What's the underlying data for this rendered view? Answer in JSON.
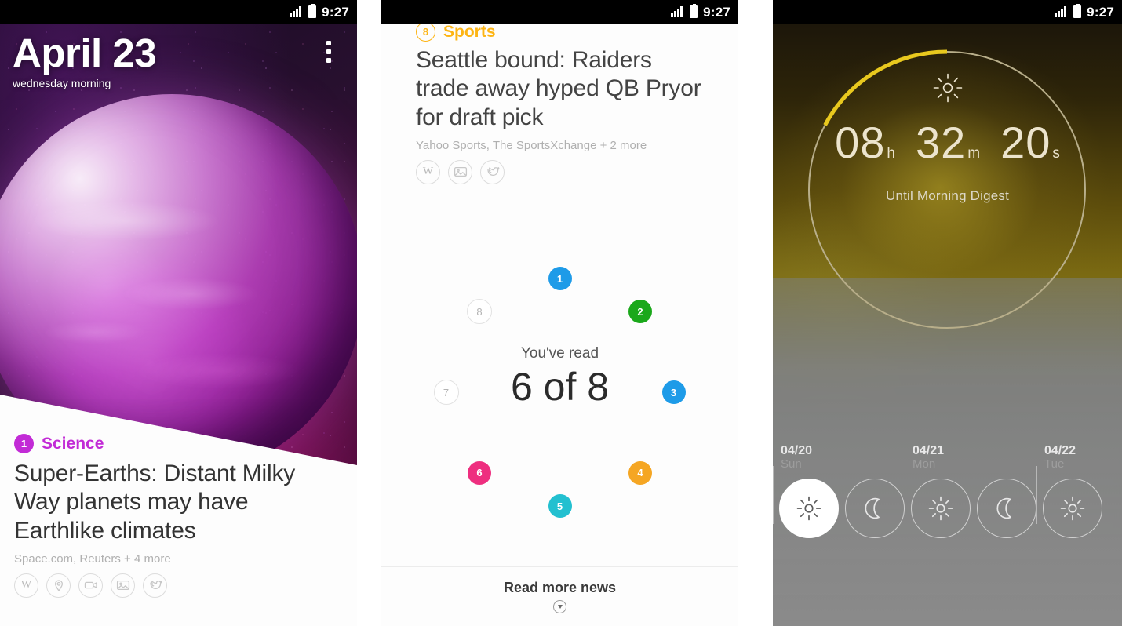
{
  "statusbar": {
    "time": "9:27",
    "signal_icon": "signal-bars-icon",
    "battery_icon": "battery-icon"
  },
  "panel1": {
    "name": "news-digest-cover",
    "date_title": "April 23",
    "date_subtitle": "wednesday morning",
    "overflow_icon": "overflow-menu-icon",
    "story": {
      "rank": "1",
      "category": "Science",
      "category_color": "#C22BD6",
      "headline": "Super-Earths: Distant Milky Way planets may have Earthlike climates",
      "sources": "Space.com, Reuters + 4 more",
      "media_icons": [
        "wikipedia-icon",
        "location-pin-icon",
        "video-camera-icon",
        "image-icon",
        "twitter-icon"
      ]
    }
  },
  "panel2": {
    "name": "news-digest-summary",
    "story": {
      "rank": "8",
      "category": "Sports",
      "category_color": "#FDB515",
      "headline": "Seattle bound: Raiders trade away hyped QB Pryor for draft pick",
      "sources": "Yahoo Sports, The SportsXchange + 2 more",
      "media_icons": [
        "wikipedia-icon",
        "image-icon",
        "twitter-icon"
      ]
    },
    "read_progress": {
      "label": "You've read",
      "count_text": "6 of 8",
      "read": 6,
      "total": 8,
      "items": [
        {
          "number": "1",
          "read": true,
          "color": "#1E9BE8"
        },
        {
          "number": "2",
          "read": true,
          "color": "#1AA81A"
        },
        {
          "number": "3",
          "read": true,
          "color": "#1E9BE8"
        },
        {
          "number": "4",
          "read": true,
          "color": "#F5A623"
        },
        {
          "number": "5",
          "read": true,
          "color": "#23C0D0"
        },
        {
          "number": "6",
          "read": true,
          "color": "#EE2E7F"
        },
        {
          "number": "7",
          "read": false,
          "color": "#FFFFFF"
        },
        {
          "number": "8",
          "read": false,
          "color": "#FFFFFF"
        }
      ]
    },
    "footer": {
      "label": "Read more news",
      "icon": "chevron-down-circle-icon"
    }
  },
  "panel3": {
    "name": "digest-countdown",
    "weather_icon": "sun-icon",
    "countdown": {
      "hours": "08",
      "hours_suffix": "h",
      "minutes": "32",
      "minutes_suffix": "m",
      "seconds": "20",
      "seconds_suffix": "s",
      "caption": "Until Morning Digest"
    },
    "progress_arc": {
      "accent_color": "#E8C81E",
      "track_color": "#b8ae8a",
      "start_deg": -90,
      "sweep_deg": -62
    },
    "forecast": [
      {
        "date": "04/20",
        "dow": "Sun",
        "slots": [
          {
            "icon": "sun-icon",
            "active": true
          },
          {
            "icon": "moon-icon",
            "active": false
          }
        ]
      },
      {
        "date": "04/21",
        "dow": "Mon",
        "slots": [
          {
            "icon": "sun-icon",
            "active": false
          },
          {
            "icon": "moon-icon",
            "active": false
          }
        ]
      },
      {
        "date": "04/22",
        "dow": "Tue",
        "slots": [
          {
            "icon": "sun-icon",
            "active": false
          }
        ]
      }
    ]
  }
}
